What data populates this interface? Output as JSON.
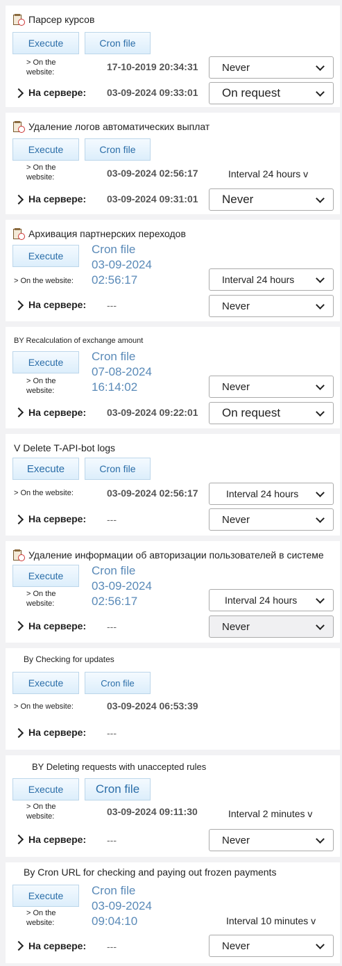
{
  "common": {
    "execute": "Execute",
    "cron_file": "Cron file",
    "on_site_two": "> On the website:",
    "on_site_one": "> On the website:",
    "on_server": "На сервере:",
    "dash": "---"
  },
  "tasks": [
    {
      "title": "Парсер курсов",
      "site_date": "17-10-2019 20:34:31",
      "site_select": "Never",
      "server_date": "03-09-2024 09:33:01",
      "server_select": "On request"
    },
    {
      "title": "Удаление логов автоматических выплат",
      "site_date": "03-09-2024 02:56:17",
      "site_select": "Interval 24 hours v",
      "server_date": "03-09-2024 09:31:01",
      "server_select": "Never"
    },
    {
      "title": "Архивация партнерских переходов",
      "cron_lines": [
        "Cron file",
        "03-09-2024",
        "02:56:17"
      ],
      "site_select": "Interval 24 hours",
      "server_date": "---",
      "server_select": "Never"
    },
    {
      "title": "BY Recalculation of exchange amount",
      "cron_lines": [
        "Cron file",
        "07-08-2024",
        "16:14:02"
      ],
      "site_select": "Never",
      "server_date": "03-09-2024 09:22:01",
      "server_select": "On request"
    },
    {
      "title": "V Delete T-API-bot logs",
      "site_date": "03-09-2024 02:56:17",
      "site_select": "Interval 24 hours",
      "server_date": "---",
      "server_select": "Never"
    },
    {
      "title": "Удаление информации об авторизации пользователей в системе",
      "cron_lines": [
        "Cron file",
        "03-09-2024",
        "02:56:17"
      ],
      "site_select": "Interval 24 hours",
      "server_date": "---",
      "server_select": "Never"
    },
    {
      "title": "By Checking for updates",
      "site_date": "03-09-2024 06:53:39",
      "server_date": "---"
    },
    {
      "title": "BY Deleting requests with unaccepted rules",
      "site_date": "03-09-2024 09:11:30",
      "site_select": "Interval 2 minutes v",
      "server_date": "---",
      "server_select": "Never"
    },
    {
      "title": "By Cron URL for checking and paying out frozen payments",
      "cron_lines": [
        "Cron file",
        "03-09-2024",
        "09:04:10"
      ],
      "site_select": "Interval 10 minutes v",
      "server_date": "---",
      "server_select": "Never"
    }
  ]
}
